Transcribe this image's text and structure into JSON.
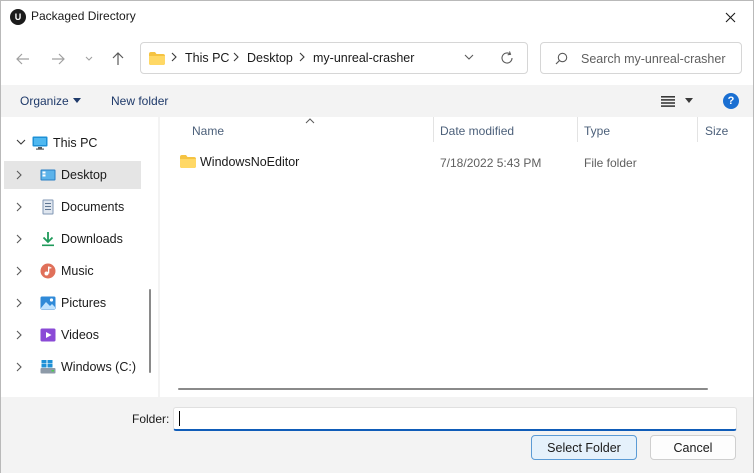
{
  "window": {
    "title": "Packaged Directory",
    "app_icon": "unreal-engine-icon"
  },
  "nav": {
    "back_icon": "arrow-left-icon",
    "forward_icon": "arrow-right-icon",
    "recent_icon": "chevron-down-icon",
    "up_icon": "arrow-up-icon"
  },
  "address": {
    "crumbs": [
      "This PC",
      "Desktop",
      "my-unreal-crasher"
    ]
  },
  "search": {
    "placeholder": "Search my-unreal-crasher"
  },
  "commands": {
    "organize_label": "Organize",
    "new_folder_label": "New folder"
  },
  "sidebar": {
    "items": [
      {
        "label": "This PC",
        "icon": "monitor-icon",
        "expanded": true
      },
      {
        "label": "Desktop",
        "icon": "desktop-icon",
        "selected": true
      },
      {
        "label": "Documents",
        "icon": "document-icon"
      },
      {
        "label": "Downloads",
        "icon": "download-icon"
      },
      {
        "label": "Music",
        "icon": "music-icon"
      },
      {
        "label": "Pictures",
        "icon": "picture-icon"
      },
      {
        "label": "Videos",
        "icon": "video-icon"
      },
      {
        "label": "Windows (C:)",
        "icon": "drive-icon"
      }
    ]
  },
  "file_list": {
    "columns": [
      "Name",
      "Date modified",
      "Type",
      "Size"
    ],
    "rows": [
      {
        "name": "WindowsNoEditor",
        "date_modified": "7/18/2022 5:43 PM",
        "type": "File folder",
        "size": ""
      }
    ]
  },
  "footer": {
    "folder_label": "Folder:",
    "folder_value": "",
    "select_label": "Select Folder",
    "cancel_label": "Cancel"
  },
  "colors": {
    "accent": "#0f5cb8",
    "folder_yellow": "#f5c342",
    "help_blue": "#1a6fd2"
  }
}
